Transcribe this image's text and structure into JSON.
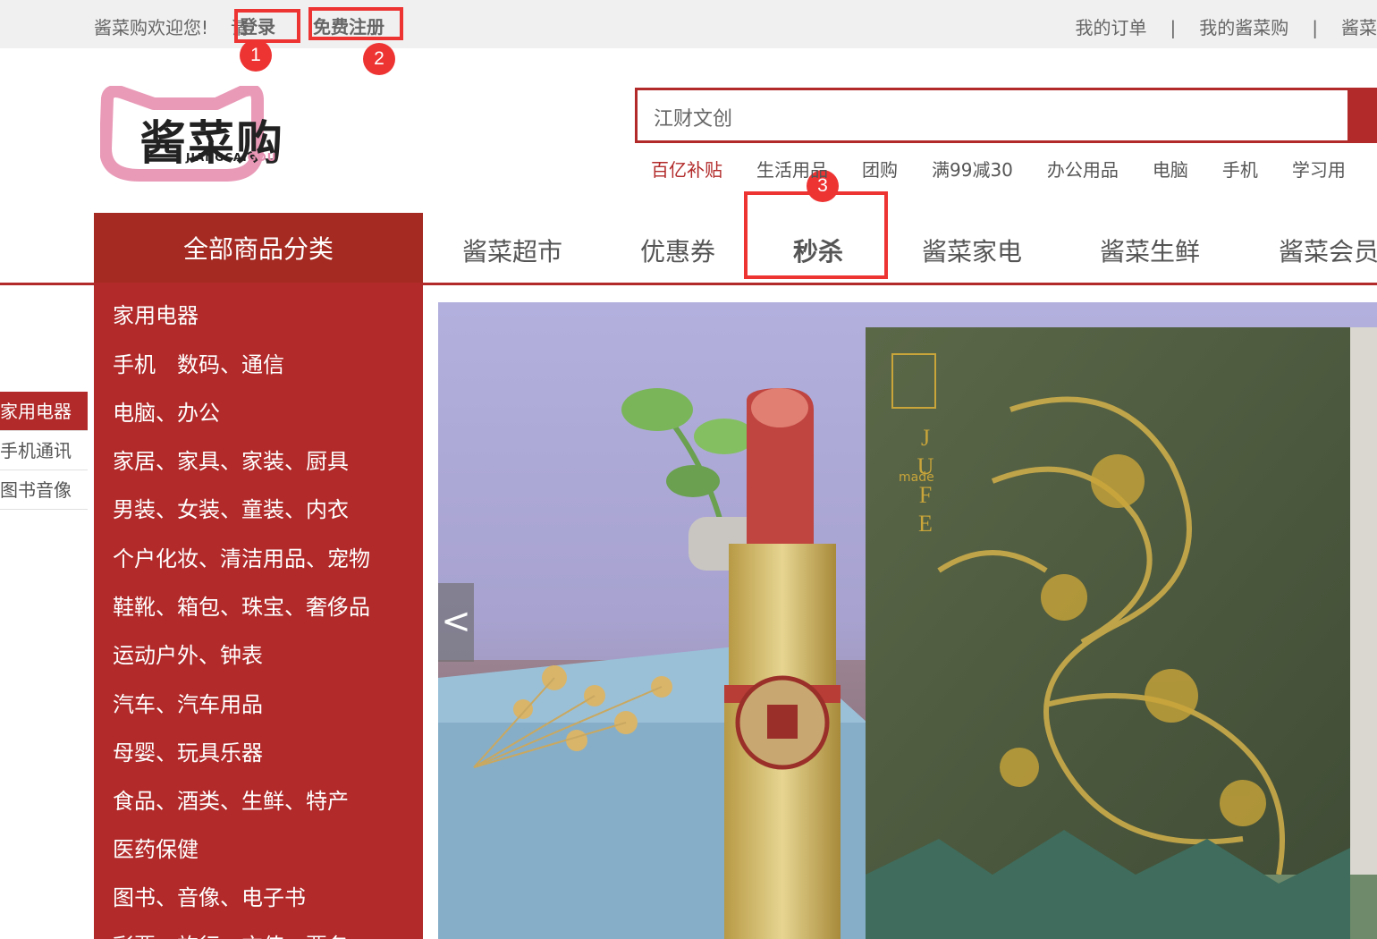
{
  "topbar": {
    "welcome": "酱菜购欢迎您!",
    "please": "请",
    "login": "登录",
    "register": "免费注册",
    "links": [
      "我的订单",
      "我的酱菜购",
      "酱菜"
    ]
  },
  "annotations": [
    "1",
    "2",
    "3"
  ],
  "logo": {
    "text": "酱菜购",
    "sub_dark": "JIANGCAI",
    "sub_pink": "GOU"
  },
  "search": {
    "value": "江财文创"
  },
  "hotwords": [
    "百亿补贴",
    "生活用品",
    "团购",
    "满99减30",
    "办公用品",
    "电脑",
    "手机",
    "学习用"
  ],
  "nav": {
    "all_categories": "全部商品分类",
    "items": [
      "酱菜超市",
      "优惠券",
      "秒杀",
      "酱菜家电",
      "酱菜生鲜",
      "酱菜会员"
    ]
  },
  "categories": [
    "家用电器",
    "手机　数码、通信",
    "电脑、办公",
    "家居、家具、家装、厨具",
    "男装、女装、童装、内衣",
    "个户化妆、清洁用品、宠物",
    "鞋靴、箱包、珠宝、奢侈品",
    "运动户外、钟表",
    "汽车、汽车用品",
    "母婴、玩具乐器",
    "食品、酒类、生鲜、特产",
    "医药保健",
    "图书、音像、电子书",
    "彩票、旅行、充值、票务"
  ],
  "floor_nav": [
    "家用电器",
    "手机通讯",
    "图书音像"
  ],
  "banner": {
    "prev_arrow": "<",
    "box_text": "JUFE",
    "box_small": "made",
    "colors": {
      "lipstick_red": "#c0443f",
      "gold": "#c9a53a",
      "box_green": "#4e5a3c",
      "bg_lavender": "#a9a6d6",
      "book_blue": "#8fb6cf"
    }
  },
  "colors": {
    "brand_red": "#b22a2a",
    "brand_dark_red": "#a42a22",
    "annotation_red": "#ee3333"
  }
}
